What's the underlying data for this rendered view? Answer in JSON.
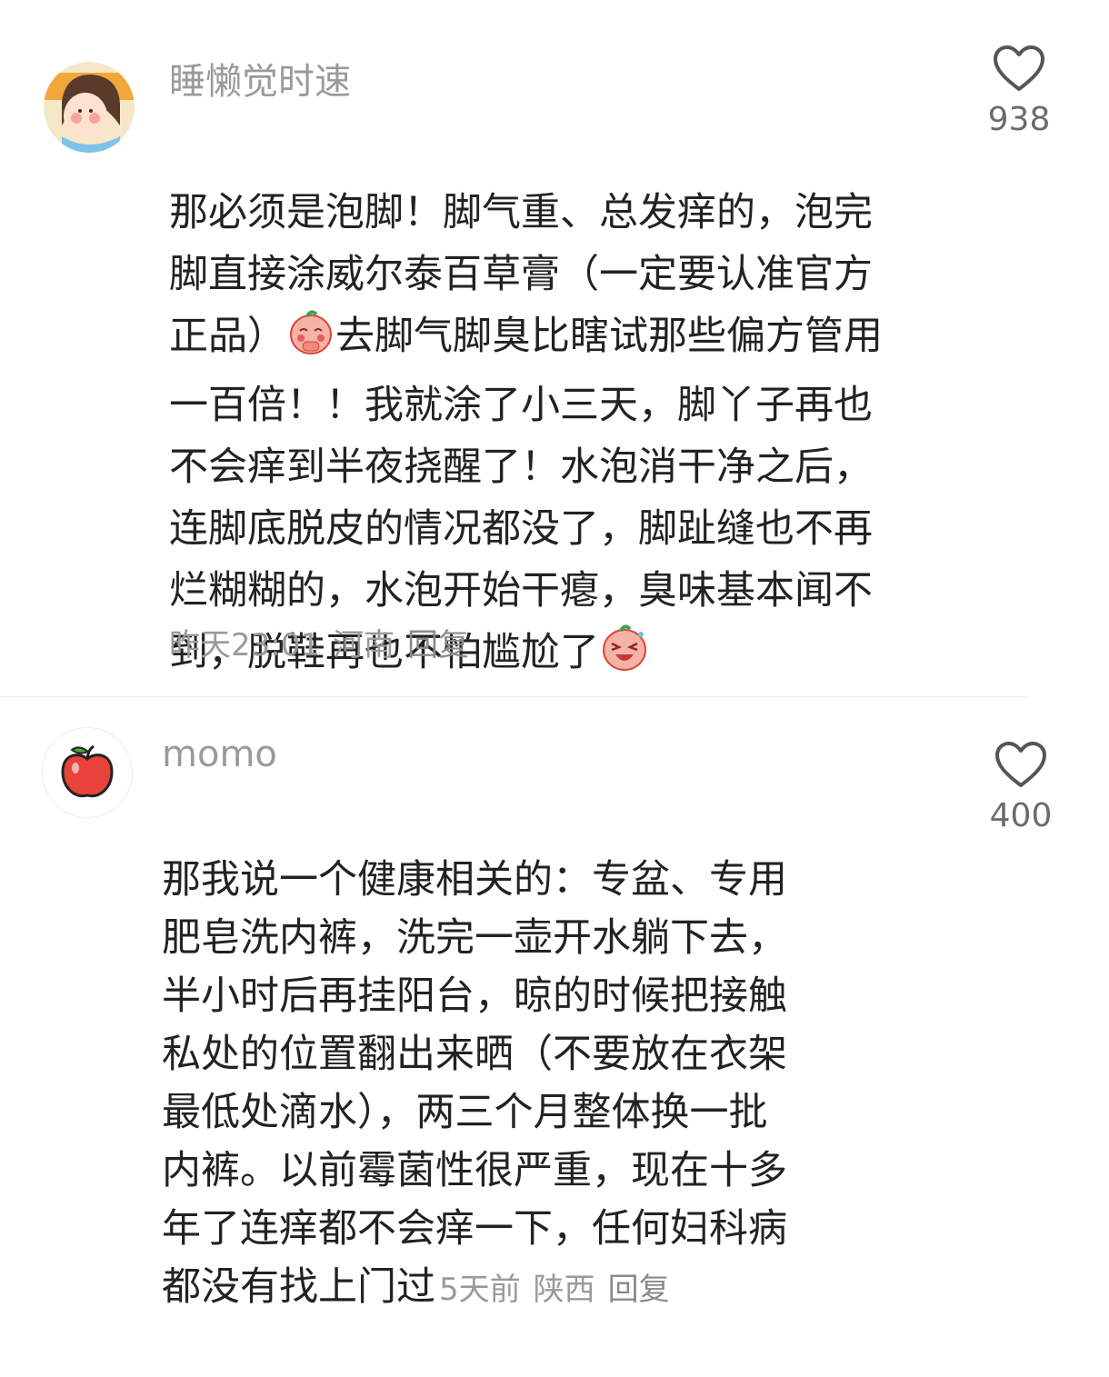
{
  "comments": [
    {
      "username": "睡懒觉时速",
      "avatar_icon": "cartoon-girl-avatar-icon",
      "text_part1": "那必须是泡脚！脚气重、总发痒的，泡完\n脚直接涂威尔泰百草膏（一定要认准官方\n正品）",
      "emoji1": "shy-peach-emoji-icon",
      "text_part2": "去脚气脚臭比瞎试那些偏方管用\n一百倍！！我就涂了小三天，脚丫子再也\n不会痒到半夜挠醒了！水泡消干净之后，\n连脚底脱皮的情况都没了，脚趾缝也不再\n烂糊糊的，水泡开始干瘪，臭味基本闻不\n到，脱鞋再也不怕尴尬了",
      "emoji2": "laughing-peach-emoji-icon",
      "time": "昨天23:01",
      "location": "河南",
      "reply": "回复",
      "likes": "938"
    },
    {
      "username": "momo",
      "avatar_icon": "apple-avatar-icon",
      "text_main": "那我说一个健康相关的：专盆、专用\n肥皂洗内裤，洗完一壶开水躺下去，\n半小时后再挂阳台，晾的时候把接触\n私处的位置翻出来晒（不要放在衣架\n最低处滴水），两三个月整体换一批\n内裤。以前霉菌性很严重，现在十多\n年了连痒都不会痒一下，任何妇科病",
      "text_last": "都没有找上门过",
      "time": "5天前",
      "location": "陕西",
      "reply": "回复",
      "likes": "400"
    }
  ],
  "colors": {
    "text": "#222222",
    "meta": "#9a9a9a",
    "divider": "#ececec",
    "heart_outline": "#555555"
  }
}
